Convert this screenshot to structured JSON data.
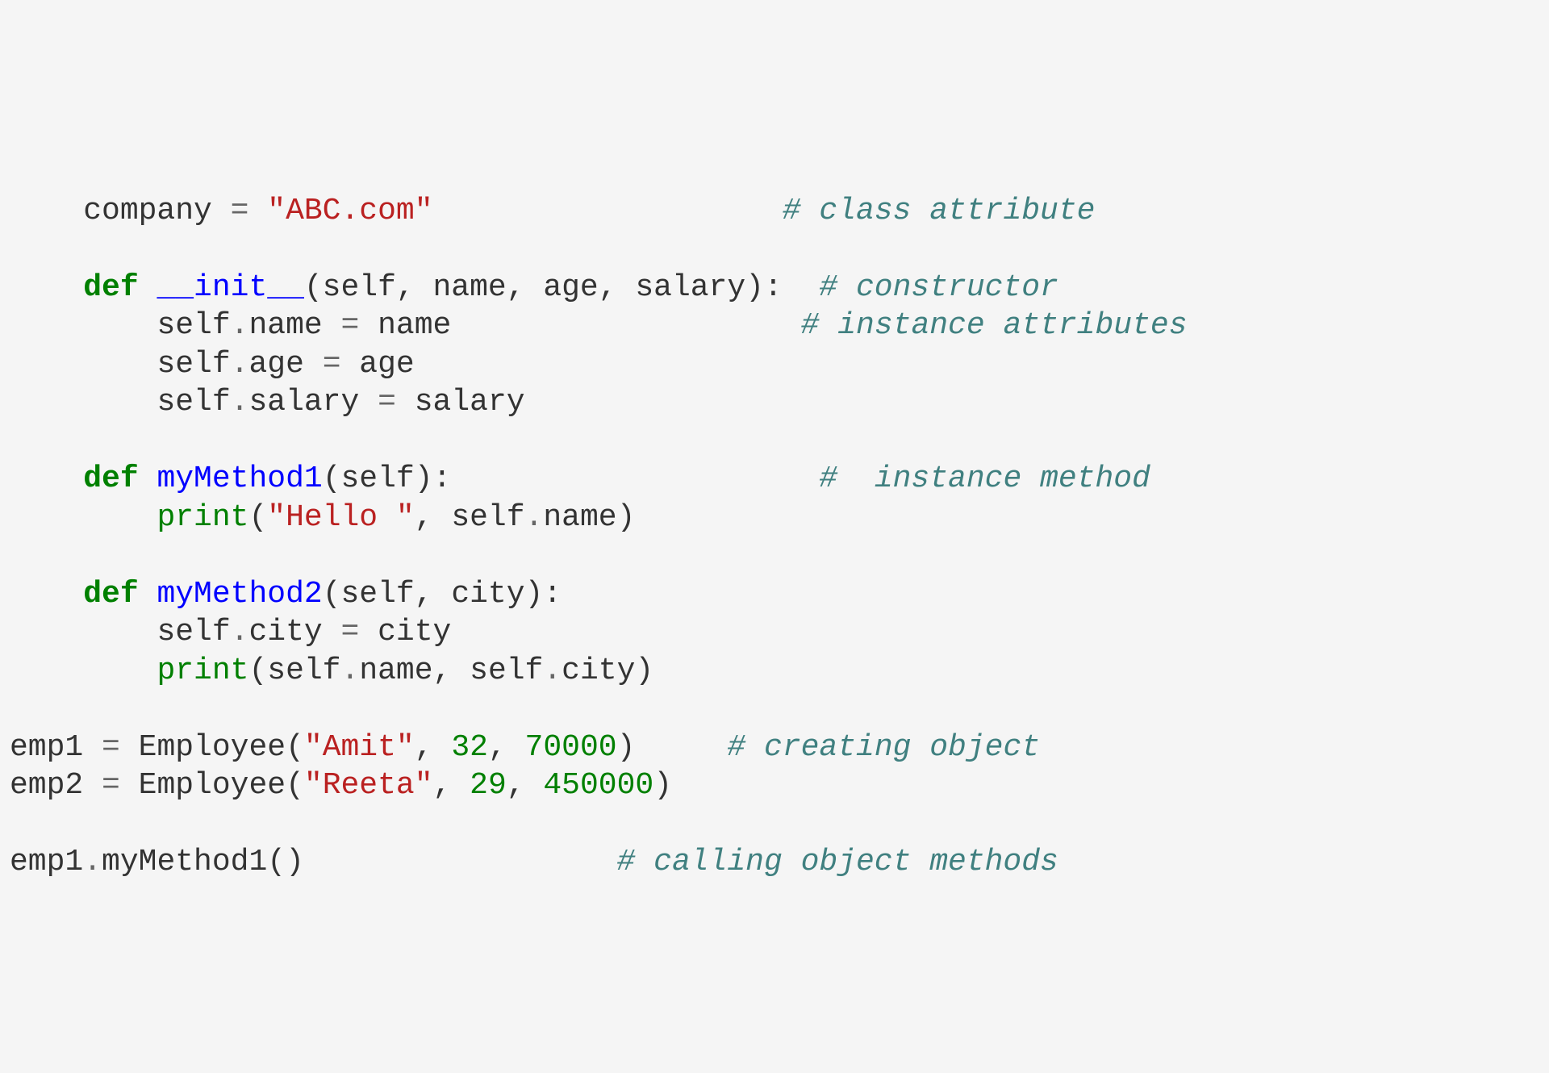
{
  "code": {
    "l01_indent": "    ",
    "l01_var": "company ",
    "l01_op": "=",
    "l01_str": " \"ABC.com\"",
    "l01_pad": "                   ",
    "l01_comment": "# class attribute",
    "l02": "",
    "l03_indent": "    ",
    "l03_def": "def",
    "l03_fn": " __init__",
    "l03_params": "(self, name, age, salary):  ",
    "l03_comment": "# constructor",
    "l04_indent": "        ",
    "l04_body": "self",
    "l04_op1": ".",
    "l04_attr": "name ",
    "l04_op2": "=",
    "l04_rhs": " name",
    "l04_pad": "                   ",
    "l04_comment": "# instance attributes",
    "l05_indent": "        ",
    "l05_body": "self",
    "l05_op1": ".",
    "l05_attr": "age ",
    "l05_op2": "=",
    "l05_rhs": " age",
    "l06_indent": "        ",
    "l06_body": "self",
    "l06_op1": ".",
    "l06_attr": "salary ",
    "l06_op2": "=",
    "l06_rhs": " salary",
    "l07": "",
    "l08_indent": "    ",
    "l08_def": "def",
    "l08_fn": " myMethod1",
    "l08_params": "(self):",
    "l08_pad": "                    ",
    "l08_comment": "#  instance method",
    "l09_indent": "        ",
    "l09_print": "print",
    "l09_open": "(",
    "l09_str": "\"Hello \"",
    "l09_rest": ", self",
    "l09_op": ".",
    "l09_attr": "name)",
    "l10": "",
    "l11_indent": "    ",
    "l11_def": "def",
    "l11_fn": " myMethod2",
    "l11_params": "(self, city):",
    "l12_indent": "        ",
    "l12_body": "self",
    "l12_op1": ".",
    "l12_attr": "city ",
    "l12_op2": "=",
    "l12_rhs": " city",
    "l13_indent": "        ",
    "l13_print": "print",
    "l13_open": "(self",
    "l13_op1": ".",
    "l13_attr1": "name, self",
    "l13_op2": ".",
    "l13_attr2": "city)",
    "l14": "",
    "l15_var": "emp1 ",
    "l15_op": "=",
    "l15_call": " Employee(",
    "l15_str": "\"Amit\"",
    "l15_c1": ", ",
    "l15_n1": "32",
    "l15_c2": ", ",
    "l15_n2": "70000",
    "l15_close": ")     ",
    "l15_comment": "# creating object",
    "l16_var": "emp2 ",
    "l16_op": "=",
    "l16_call": " Employee(",
    "l16_str": "\"Reeta\"",
    "l16_c1": ", ",
    "l16_n1": "29",
    "l16_c2": ", ",
    "l16_n2": "450000",
    "l16_close": ")",
    "l17": "",
    "l18_body": "emp1",
    "l18_op": ".",
    "l18_call": "myMethod1()",
    "l18_pad": "                 ",
    "l18_comment": "# calling object methods"
  }
}
